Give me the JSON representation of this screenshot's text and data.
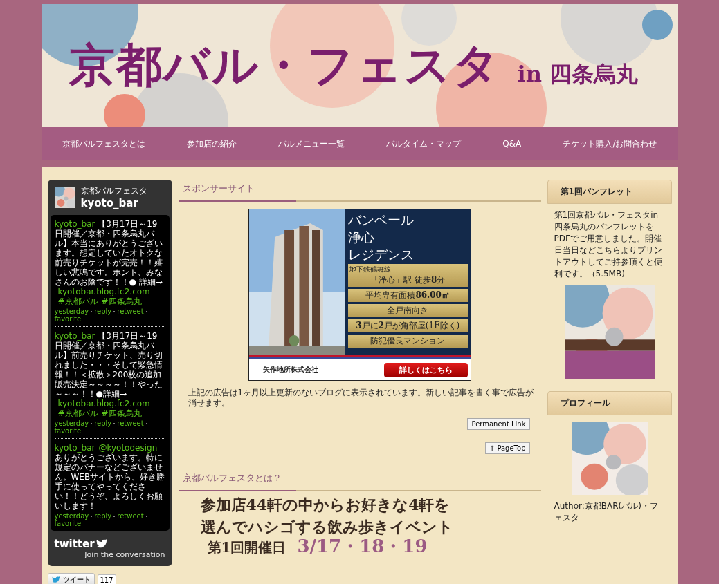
{
  "header": {
    "title": "京都バル・フェスタ",
    "subtitle": "in 四条烏丸"
  },
  "nav": [
    {
      "label": "京都バルフェスタとは"
    },
    {
      "label": "参加店の紹介"
    },
    {
      "label": "バルメニュー一覧"
    },
    {
      "label": "バルタイム・マップ"
    },
    {
      "label": "Q&A"
    },
    {
      "label": "チケット購入/お問合わせ"
    }
  ],
  "twitter_widget": {
    "display_name": "京都バルフェスタ",
    "handle": "kyoto_bar",
    "tweets": [
      {
        "segments": [
          {
            "kind": "link",
            "text": "kyoto_bar"
          },
          {
            "kind": "text",
            "text": " 【3月17日～19日開催／京都・四条烏丸バル】本当にありがとうございます。想定していたオトクな前売りチケットが完売！！嬉しい悲鳴です。ホント、みなさんのお陰です！！● 詳細→ "
          },
          {
            "kind": "link",
            "text": "kyotobar.blog.fc2.com"
          },
          {
            "kind": "link",
            "text": "#京都バル"
          },
          {
            "kind": "link",
            "text": "#四条烏丸"
          }
        ],
        "actions": [
          "yesterday",
          "reply",
          "retweet",
          "favorite"
        ]
      },
      {
        "segments": [
          {
            "kind": "link",
            "text": "kyoto_bar"
          },
          {
            "kind": "text",
            "text": " 【3月17日～19日開催／京都・四条烏丸バル】前売りチケット、売り切れました・・・そして緊急情報！！＜拡散＞200枚の追加販売決定～～～～！！やった～～～！！●詳細→ "
          },
          {
            "kind": "link",
            "text": "kyotobar.blog.fc2.com"
          },
          {
            "kind": "link",
            "text": "#京都バル"
          },
          {
            "kind": "link",
            "text": "#四条烏丸"
          }
        ],
        "actions": [
          "yesterday",
          "reply",
          "retweet",
          "favorite"
        ]
      },
      {
        "segments": [
          {
            "kind": "link",
            "text": "kyoto_bar"
          },
          {
            "kind": "link",
            "text": "@kyotodesign"
          },
          {
            "kind": "text",
            "text": " ありがとうございます。特に規定のバナーなどございません。WEBサイトから、好き勝手に使ってやってください！！どうぞ、よろしくお願いします！"
          }
        ],
        "actions": [
          "yesterday",
          "reply",
          "retweet",
          "favorite"
        ]
      }
    ],
    "logo": "twitter",
    "join": "Join the conversation"
  },
  "share": {
    "label": "ツイート",
    "count": "117"
  },
  "sponsor": {
    "heading": "スポンサーサイト",
    "ad": {
      "title": [
        "バンベール",
        "浄心",
        "レジデンス"
      ],
      "features": [
        {
          "caption": "地下鉄鶴舞線",
          "text": "「浄心」駅 徒歩**8**分"
        },
        {
          "text": "平均専有面積**86.00㎡**"
        },
        {
          "text": "全戸南向き"
        },
        {
          "text": "**3**戸に**2**戸が角部屋(1F除く)"
        },
        {
          "text": "防犯優良マンション"
        }
      ],
      "company": "矢作地所株式会社",
      "cta": "詳しくはこちら"
    },
    "notice": "上記の広告は1ヶ月以上更新のないブログに表示されています。新しい記事を書く事で広告が消せます。",
    "permalink": "Permanent Link",
    "pagetop": "↑ PageTop"
  },
  "about": {
    "heading": "京都バルフェスタとは？",
    "lines": [
      "参加店**44軒**の中からお好きな4軒を",
      "選んでハシゴする飲み歩きイベント"
    ],
    "date_label": "第1回開催日",
    "date": "3/17・18・19"
  },
  "pamphlet": {
    "heading": "第1回パンフレット",
    "text": "第1回京都バル・フェスタin四条烏丸のパンフレットをPDFでご用意しました。開催日当日などこちらよりプリントアウトしてご持参頂くと便利です。（5.5MB)"
  },
  "profile": {
    "heading": "プロフィール",
    "author": "Author:京都BAR(バル)・フェスタ"
  }
}
